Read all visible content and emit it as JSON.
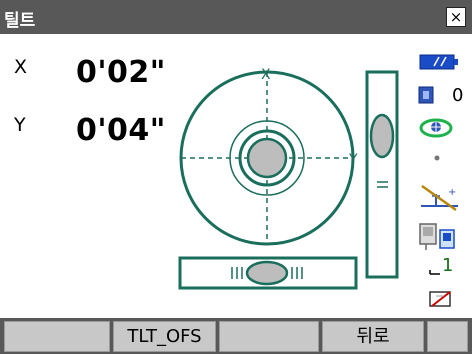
{
  "window": {
    "title": "틸트",
    "close_glyph": "×"
  },
  "readings": {
    "x": {
      "label": "X",
      "value": "0'02\""
    },
    "y": {
      "label": "Y",
      "value": "0'04\""
    }
  },
  "level": {
    "circle_x_label": "X",
    "circle_y_label": "Y",
    "accent_color": "#1a6e5c",
    "bubble_color": "#bdbdbd"
  },
  "status": {
    "battery_icon": "battery-icon",
    "memory_count": "0",
    "tilt_comp_icon": "tilt-compensation-icon",
    "target_icon": "prism-target-icon",
    "laser_plummet_count": "1"
  },
  "softkeys": [
    "",
    "TLT_OFS",
    "",
    "뒤로",
    ""
  ]
}
